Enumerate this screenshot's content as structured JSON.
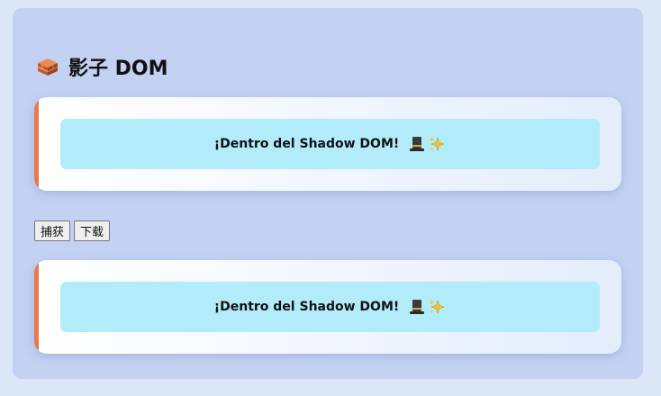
{
  "header": {
    "title": "影子 DOM",
    "icon": "brick-icon"
  },
  "cards": [
    {
      "text": "¡Dentro del Shadow DOM!",
      "icons": [
        "top-hat-icon",
        "sparkles-icon"
      ]
    },
    {
      "text": "¡Dentro del Shadow DOM!",
      "icons": [
        "top-hat-icon",
        "sparkles-icon"
      ]
    }
  ],
  "toolbar": {
    "capture_label": "捕获",
    "download_label": "下载"
  },
  "colors": {
    "page_bg": "#dbe6f7",
    "panel_bg": "#c3d1f3",
    "accent_stripe": "#f0764a",
    "inner_bg": "#b2ecfb"
  }
}
